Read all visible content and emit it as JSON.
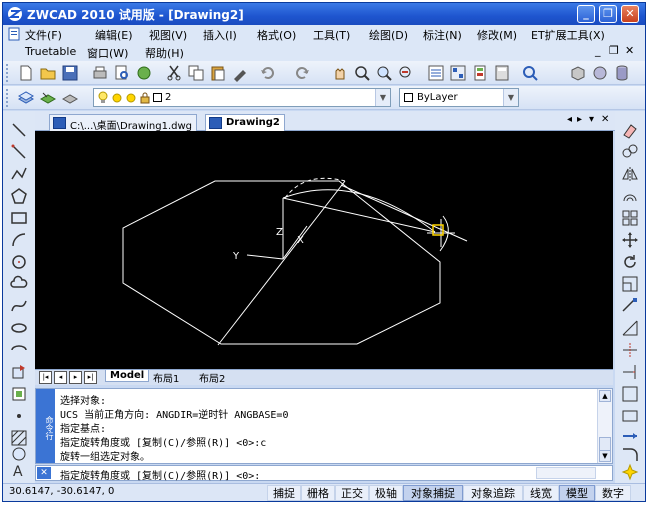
{
  "window": {
    "title": "ZWCAD 2010 试用版 - [Drawing2]",
    "min_label": "_",
    "restore_label": "❐",
    "close_label": "✕"
  },
  "menu": {
    "row1": [
      "文件(F)",
      "编辑(E)",
      "视图(V)",
      "插入(I)",
      "格式(O)",
      "工具(T)",
      "绘图(D)",
      "标注(N)",
      "修改(M)",
      "ET扩展工具(X)"
    ],
    "row2": [
      "Truetable",
      "窗口(W)",
      "帮助(H)"
    ],
    "mdi_min": "_",
    "mdi_restore": "❐",
    "mdi_close": "✕"
  },
  "layer_toolbar": {
    "layer_value": "2",
    "color_value": "ByLayer"
  },
  "doc_tabs": [
    {
      "label": "C:\\...\\桌面\\Drawing1.dwg"
    },
    {
      "label": "Drawing2"
    }
  ],
  "doc_controls": {
    "prev": "◂",
    "next": "▸",
    "menu": "▾",
    "close": "✕"
  },
  "canvas": {
    "ucs_x": "X",
    "ucs_y": "Y",
    "ucs_z": "Z"
  },
  "layout_tabs": {
    "nav": [
      "|◂",
      "◂",
      "▸",
      "▸|"
    ],
    "tabs": [
      "Model",
      "布局1",
      "布局2"
    ]
  },
  "command": {
    "side_label": "命令行",
    "lines": [
      "选择对象:",
      "UCS 当前正角方向: ANGDIR=逆时针  ANGBASE=0",
      "指定基点:",
      "指定旋转角度或 [复制(C)/参照(R)] <0>:c",
      "旋转一组选定对象。"
    ],
    "prompt": "指定旋转角度或 [复制(C)/参照(R)] <0>:",
    "close_label": "✕"
  },
  "status": {
    "coordinates": "30.6147, -30.6147, 0",
    "toggles": [
      {
        "label": "捕捉",
        "on": false
      },
      {
        "label": "栅格",
        "on": false
      },
      {
        "label": "正交",
        "on": false
      },
      {
        "label": "极轴",
        "on": false
      },
      {
        "label": "对象捕捉",
        "on": true
      },
      {
        "label": "对象追踪",
        "on": false
      },
      {
        "label": "线宽",
        "on": false
      },
      {
        "label": "模型",
        "on": true
      },
      {
        "label": "数字",
        "on": false
      }
    ]
  },
  "colors": {
    "titlebar": "#1e55cf",
    "canvas_bg": "#000000",
    "entity": "#ffffff",
    "grip": "#ffd500"
  }
}
